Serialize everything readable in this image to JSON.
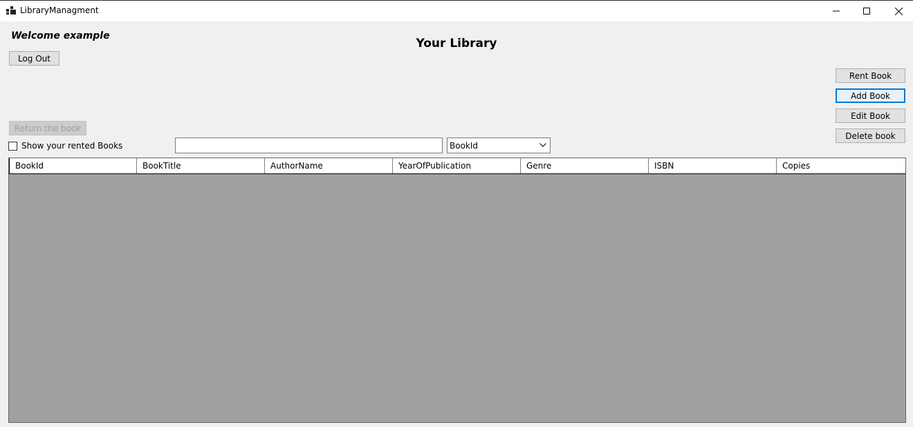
{
  "window": {
    "title": "LibraryManagment",
    "icon": "app-icon"
  },
  "header": {
    "welcome": "Welcome example",
    "page_title": "Your Library",
    "logout_label": "Log Out"
  },
  "actions": {
    "rent_book": "Rent Book",
    "add_book": "Add Book",
    "edit_book": "Edit Book",
    "delete_book": "Delete book",
    "return_book": "Return the book"
  },
  "filters": {
    "show_rented_label": "Show your rented Books",
    "show_rented_checked": false,
    "search_value": "",
    "search_placeholder": "",
    "search_field_selected": "BookId"
  },
  "table": {
    "columns": [
      "BookId",
      "BookTitle",
      "AuthorName",
      "YearOfPublication",
      "Genre",
      "ISBN",
      "Copies"
    ],
    "rows": []
  },
  "colors": {
    "focus_accent": "#0078d7",
    "grid_background": "#a0a0a0",
    "form_background": "#f0f0f0"
  }
}
